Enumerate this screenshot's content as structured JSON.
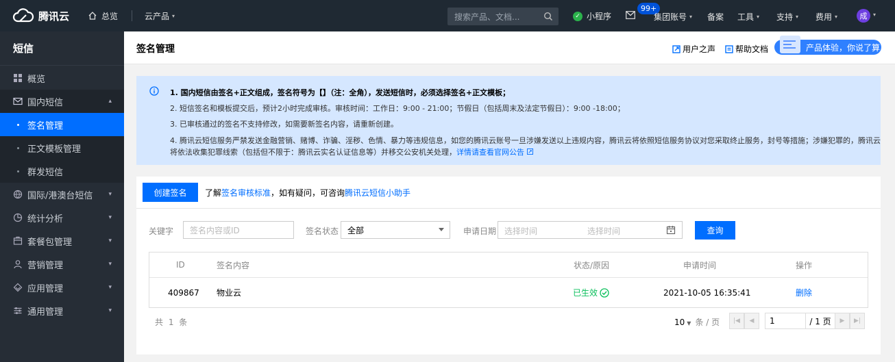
{
  "topbar": {
    "brand": "腾讯云",
    "home": "总览",
    "products": "云产品",
    "search_placeholder": "搜索产品、文档...",
    "mini_program": "小程序",
    "mail_badge": "99+",
    "group_account": "集团账号",
    "beian": "备案",
    "tools": "工具",
    "support": "支持",
    "fee": "费用",
    "avatar_text": "成"
  },
  "sidebar": {
    "title": "短信",
    "items": [
      {
        "label": "概览",
        "icon": "grid-icon"
      },
      {
        "label": "国内短信",
        "icon": "mail-icon",
        "expanded": true
      },
      {
        "label": "国际/港澳台短信",
        "icon": "globe-icon"
      },
      {
        "label": "统计分析",
        "icon": "pie-chart-icon"
      },
      {
        "label": "套餐包管理",
        "icon": "package-icon"
      },
      {
        "label": "营销管理",
        "icon": "users-icon"
      },
      {
        "label": "应用管理",
        "icon": "layers-icon"
      },
      {
        "label": "通用管理",
        "icon": "sliders-icon"
      }
    ],
    "sub_items": [
      {
        "label": "签名管理",
        "active": true
      },
      {
        "label": "正文模板管理",
        "active": false
      },
      {
        "label": "群发短信",
        "active": false
      }
    ]
  },
  "header": {
    "title": "签名管理",
    "user_voice": "用户之声",
    "help_doc": "帮助文档",
    "promo": "产品体验，你说了算"
  },
  "notice": {
    "line1": "1. 国内短信由签名+正文组成，签名符号为【】（注：全角），发送短信时，必须选择签名+正文模板；",
    "line2": "2. 短信签名和模板提交后，预计2小时完成审核。审核时间：工作日：9:00 - 21:00；节假日（包括周末及法定节假日）：9:00 -18:00；",
    "line3": "3. 已审核通过的签名不支持修改，如需要新签名内容，请重新创建。",
    "line4": "4. 腾讯云短信服务严禁发送金融营销、赌博、诈骗、淫秽、色情、暴力等违规信息，如您的腾讯云账号一旦涉嫌发送以上违规内容，腾讯云将依照短信服务协议对您采取终止服务，封号等措施；涉嫌犯罪的，腾讯云将依法收集犯罪线索（包括但不限于：腾讯云实名认证信息等）并移交公安机关处理，",
    "line4_link": "详情请查看官网公告"
  },
  "toolbar": {
    "create_label": "创建签名",
    "tip_prefix": "了解",
    "tip_link1": "签名审核标准",
    "tip_middle": "，如有疑问，可咨询",
    "tip_link2": "腾讯云短信小助手"
  },
  "filters": {
    "keyword_label": "关键字",
    "keyword_placeholder": "签名内容或ID",
    "status_label": "签名状态",
    "status_value": "全部",
    "date_label": "申请日期",
    "date_start_placeholder": "选择时间",
    "date_end_placeholder": "选择时间",
    "query_label": "查询"
  },
  "table": {
    "columns": [
      "ID",
      "签名内容",
      "状态/原因",
      "申请时间",
      "操作"
    ],
    "rows": [
      {
        "id": "409867",
        "content": "物业云",
        "status": "已生效",
        "time": "2021-10-05 16:35:41",
        "action": "删除"
      }
    ]
  },
  "pagination": {
    "total": "共 1 条",
    "page_size": "10",
    "page_size_unit": "条 / 页",
    "current_page": "1",
    "total_pages": "/ 1 页"
  },
  "colors": {
    "primary": "#006eff",
    "success": "#0abf5b",
    "topbar": "#1f2933",
    "sidebar": "#262d36"
  }
}
